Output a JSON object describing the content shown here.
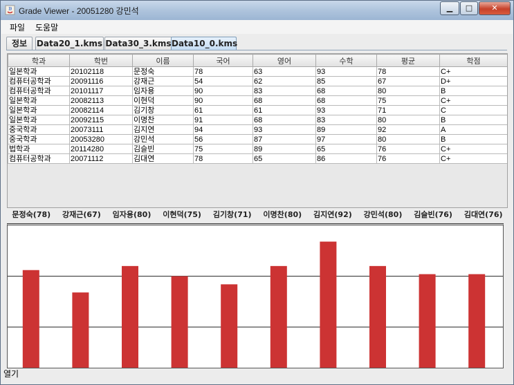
{
  "window": {
    "title": "Grade Viewer - 20051280 강민석"
  },
  "menu": [
    {
      "label": "파일"
    },
    {
      "label": "도움말"
    }
  ],
  "tabs": [
    {
      "label": "정보",
      "active": false
    },
    {
      "label": "Data20_1.kms",
      "active": false
    },
    {
      "label": "Data30_3.kms",
      "active": false
    },
    {
      "label": "Data10_0.kms",
      "active": true
    }
  ],
  "table": {
    "headers": [
      "학과",
      "학번",
      "이름",
      "국어",
      "영어",
      "수학",
      "평균",
      "학점"
    ],
    "rows": [
      [
        "일본학과",
        "20102118",
        "문정숙",
        "78",
        "63",
        "93",
        "78",
        "C+"
      ],
      [
        "컴퓨터공학과",
        "20091116",
        "강재근",
        "54",
        "62",
        "85",
        "67",
        "D+"
      ],
      [
        "컴퓨터공학과",
        "20101117",
        "임자용",
        "90",
        "83",
        "68",
        "80",
        "B"
      ],
      [
        "일본학과",
        "20082113",
        "이현덕",
        "90",
        "68",
        "68",
        "75",
        "C+"
      ],
      [
        "일본학과",
        "20082114",
        "김기창",
        "61",
        "61",
        "93",
        "71",
        "C"
      ],
      [
        "일본학과",
        "20092115",
        "이명찬",
        "91",
        "68",
        "83",
        "80",
        "B"
      ],
      [
        "중국학과",
        "20073111",
        "김지연",
        "94",
        "93",
        "89",
        "92",
        "A"
      ],
      [
        "중국학과",
        "20053280",
        "강민석",
        "56",
        "87",
        "97",
        "80",
        "B"
      ],
      [
        "법학과",
        "20114280",
        "김슬빈",
        "75",
        "89",
        "65",
        "76",
        "C+"
      ],
      [
        "컴퓨터공학과",
        "20071112",
        "김대연",
        "78",
        "65",
        "86",
        "76",
        "C+"
      ]
    ]
  },
  "chart_labels": [
    "문정숙(78)",
    "강재근(67)",
    "임자용(80)",
    "이현덕(75)",
    "김기창(71)",
    "이명찬(80)",
    "김지연(92)",
    "강민석(80)",
    "김슬빈(76)",
    "김대연(76)"
  ],
  "chart_data": {
    "type": "bar",
    "categories": [
      "문정숙(78)",
      "강재근(67)",
      "임자용(80)",
      "이현덕(75)",
      "김기창(71)",
      "이명찬(80)",
      "김지연(92)",
      "강민석(80)",
      "김슬빈(76)",
      "김대연(76)"
    ],
    "values": [
      78,
      67,
      80,
      75,
      71,
      80,
      92,
      80,
      76,
      76
    ],
    "ylim": [
      30,
      100
    ],
    "gridlines": [
      75,
      50,
      25
    ],
    "grid": true,
    "bar_color": "#cc3333"
  },
  "status": {
    "text": "열기"
  }
}
